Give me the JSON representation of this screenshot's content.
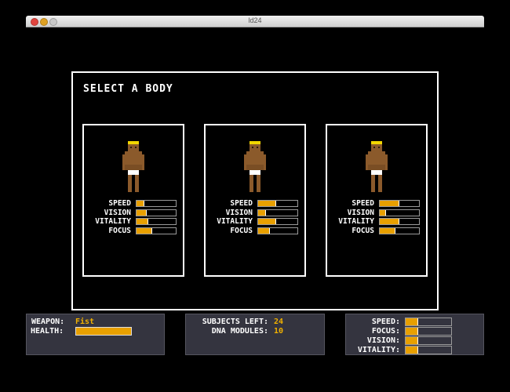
{
  "window": {
    "title": "ld24"
  },
  "dialog": {
    "title": "SELECT A BODY",
    "stat_labels": [
      "SPEED",
      "VISION",
      "VITALITY",
      "FOCUS"
    ],
    "bodies": [
      {
        "speed": 0.2,
        "vision": 0.25,
        "vitality": 0.3,
        "focus": 0.4
      },
      {
        "speed": 0.45,
        "vision": 0.2,
        "vitality": 0.45,
        "focus": 0.3
      },
      {
        "speed": 0.5,
        "vision": 0.15,
        "vitality": 0.5,
        "focus": 0.4
      }
    ]
  },
  "hud": {
    "weapon_label": "WEAPON:",
    "weapon_value": "Fist",
    "health_label": "HEALTH:",
    "health": 1.0,
    "subjects_left_label": "SUBJECTS LEFT:",
    "subjects_left_value": "24",
    "dna_modules_label": "DNA MODULES:",
    "dna_modules_value": "10",
    "player_stat_labels": [
      "SPEED:",
      "FOCUS:",
      "VISION:",
      "VITALITY:"
    ],
    "player_stats": [
      0.28,
      0.28,
      0.28,
      0.28
    ]
  },
  "colors": {
    "bar_fill": "#e8a000",
    "hud_value": "#f0b000",
    "panel_bg": "#34343f"
  },
  "icons": [
    "window-close-icon",
    "window-minimize-icon",
    "window-zoom-icon",
    "body-sprite-icon"
  ]
}
